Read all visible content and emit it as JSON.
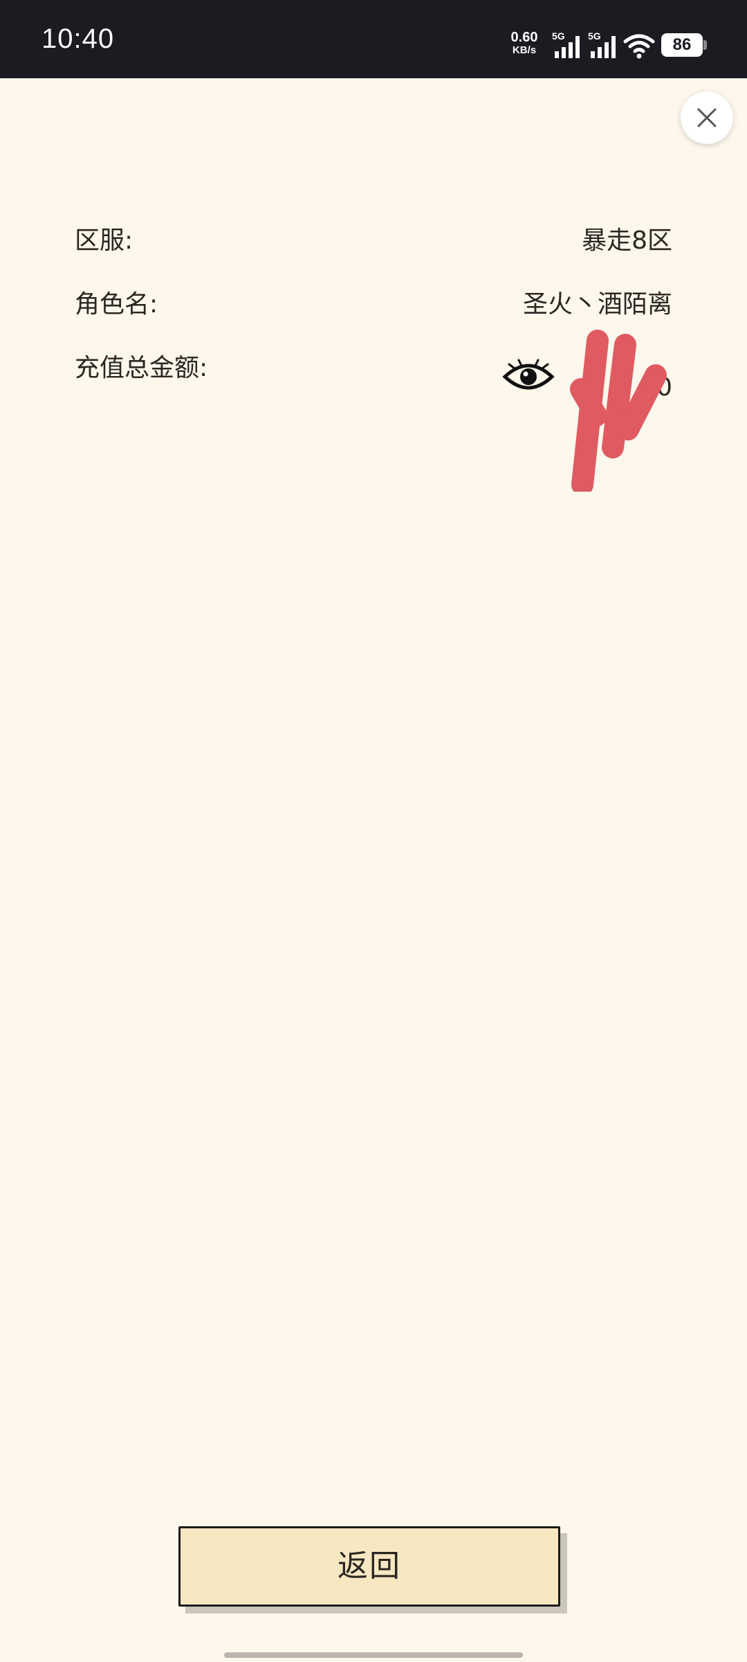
{
  "status_bar": {
    "time": "10:40",
    "net_speed_value": "0.60",
    "net_speed_unit": "KB/s",
    "sim1_label": "5G",
    "sim2_label": "5G",
    "battery": "86",
    "icons": [
      "signal-icon",
      "signal-icon",
      "wifi-icon",
      "battery-icon"
    ]
  },
  "dialog": {
    "close_icon": "close-icon",
    "rows": [
      {
        "label": "区服:",
        "value": "暴走8区"
      },
      {
        "label": "角色名:",
        "value": "圣火丶酒陌离"
      },
      {
        "label": "充值总金额:",
        "value": "0"
      }
    ],
    "amount_toggle_icon": "eye-icon",
    "redaction_color": "#e05a62"
  },
  "footer": {
    "back_label": "返回"
  },
  "colors": {
    "background": "#fdf7ec",
    "status_bar": "#1b1b22",
    "button_fill": "#f8e8c2"
  }
}
